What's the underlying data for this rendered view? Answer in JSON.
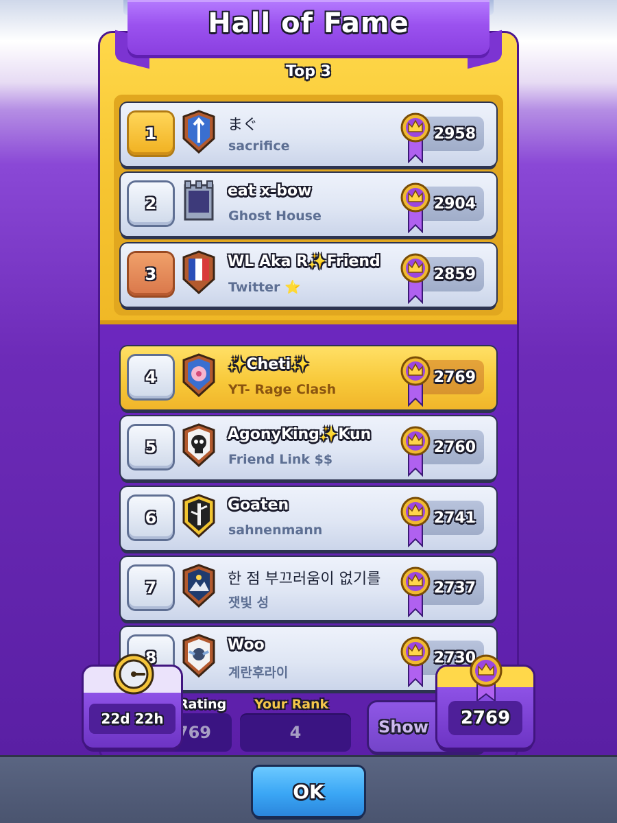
{
  "header": {
    "title": "Hall of Fame"
  },
  "top_section": {
    "title": "Top 3"
  },
  "rows": [
    {
      "rank": "1",
      "name": "まぐ",
      "clan": "sacrifice",
      "trophies": "2958",
      "rank_style": "gold",
      "badge": "arrow-badge-icon",
      "highlight": false
    },
    {
      "rank": "2",
      "name": "eat x-bow",
      "clan": "Ghost House",
      "trophies": "2904",
      "rank_style": "silver",
      "badge": "moon-tower-badge-icon",
      "highlight": false
    },
    {
      "rank": "3",
      "name": "WL Aka R✨Friend",
      "clan": "Twitter ⭐",
      "trophies": "2859",
      "rank_style": "bronze",
      "badge": "french-flag-badge-icon",
      "highlight": false
    },
    {
      "rank": "4",
      "name": "✨Cheti✨",
      "clan": "YT- Rage Clash",
      "trophies": "2769",
      "rank_style": "silver",
      "badge": "flower-badge-icon",
      "highlight": true
    },
    {
      "rank": "5",
      "name": "AgonyKing✨Kun",
      "clan": "Friend Link $$",
      "trophies": "2760",
      "rank_style": "silver",
      "badge": "skull-badge-icon",
      "highlight": false
    },
    {
      "rank": "6",
      "name": "Goaten",
      "clan": "sahnenmann",
      "trophies": "2741",
      "rank_style": "silver",
      "badge": "bamboo-badge-icon",
      "highlight": false
    },
    {
      "rank": "7",
      "name": "한 점 부끄러움이 없기를",
      "clan": "잿빛 성",
      "trophies": "2737",
      "rank_style": "silver",
      "badge": "mountain-badge-icon",
      "highlight": false
    },
    {
      "rank": "8",
      "name": "Woo",
      "clan": "계란후라이",
      "trophies": "2730",
      "rank_style": "silver",
      "badge": "winged-badge-icon",
      "highlight": false
    }
  ],
  "footer_bar": {
    "rating_label": "Rating",
    "rating_value": "769",
    "your_rank_label": "Your Rank",
    "your_rank_value": "4",
    "show_button_label": "Show",
    "timer_value": "22d 22h",
    "current_rating_value": "2769"
  },
  "ok_button": {
    "label": "OK"
  },
  "colors": {
    "panel_purple": "#6a26bc",
    "top3_gold": "#f6c531",
    "highlight_row": "#f8c93a",
    "ok_blue": "#3aa6f5"
  }
}
